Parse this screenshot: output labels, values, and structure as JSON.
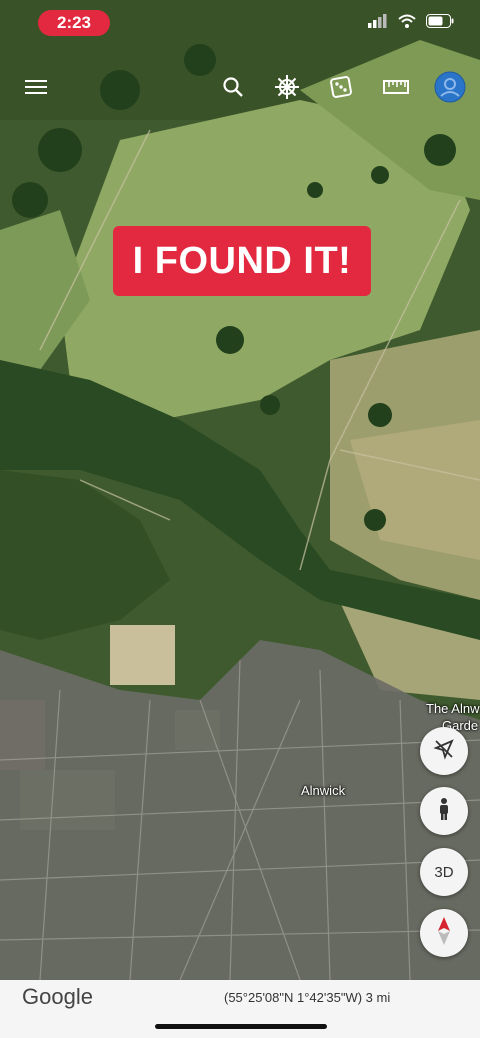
{
  "status_bar": {
    "time": "2:23"
  },
  "toolbar": {
    "menu_icon": "hamburger-menu-icon",
    "search_icon": "search-icon",
    "voyager_icon": "ship-wheel-icon",
    "feeling_lucky_icon": "dice-icon",
    "measure_icon": "ruler-icon",
    "account_icon": "account-avatar-icon"
  },
  "banner": {
    "text": "I FOUND IT!"
  },
  "map": {
    "town_label": "Alnwick",
    "poi_label_line1": "The Alnw",
    "poi_label_line2": "Garde"
  },
  "controls": {
    "threed_label": "3D",
    "compass_icon": "compass-north-icon",
    "pegman_icon": "street-view-person-icon",
    "location_off_icon": "location-off-icon"
  },
  "footer": {
    "logo": "Google",
    "coordinates": "(55°25'08\"N 1°42'35\"W) 3 mi"
  },
  "colors": {
    "accent_red": "#e2293f",
    "avatar_blue": "#2a74c9"
  }
}
